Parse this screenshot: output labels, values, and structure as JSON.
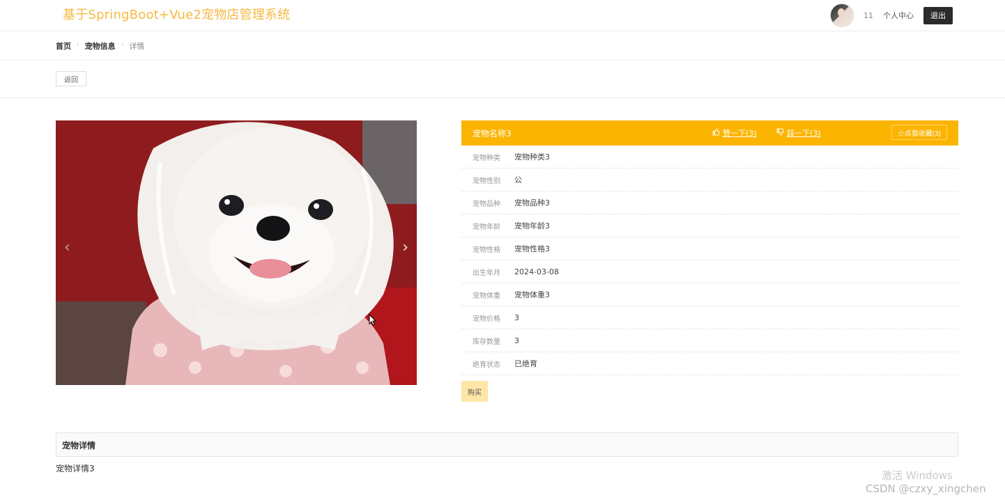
{
  "header": {
    "brand": "基于SpringBoot+Vue2宠物店管理系统",
    "user_id": "11",
    "profile_label": "个人中心",
    "logout_label": "退出"
  },
  "breadcrumb": {
    "items": [
      "首页",
      "宠物信息",
      "详情"
    ],
    "separator": "ᵌ"
  },
  "actions": {
    "back_label": "返回"
  },
  "carousel": {
    "prev_icon": "‹",
    "next_icon": "›"
  },
  "pet": {
    "name": "宠物名称3",
    "thumb_up": "赞一下(3)",
    "thumb_down": "踩一下(3)",
    "favorite": "☆点我收藏(3)",
    "fields": [
      {
        "label": "宠物种类",
        "value": "宠物种类3"
      },
      {
        "label": "宠物性别",
        "value": "公"
      },
      {
        "label": "宠物品种",
        "value": "宠物品种3"
      },
      {
        "label": "宠物年龄",
        "value": "宠物年龄3"
      },
      {
        "label": "宠物性格",
        "value": "宠物性格3"
      },
      {
        "label": "出生年月",
        "value": "2024-03-08"
      },
      {
        "label": "宠物体重",
        "value": "宠物体重3"
      },
      {
        "label": "宠物价格",
        "value": "3"
      },
      {
        "label": "库存数量",
        "value": "3"
      },
      {
        "label": "绝育状态",
        "value": "已绝育"
      }
    ],
    "buy_label": "购买"
  },
  "detail": {
    "title": "宠物详情",
    "content": "宠物详情3"
  },
  "watermarks": {
    "windows": "激活 Windows",
    "csdn": "CSDN @czxy_xingchen"
  },
  "colors": {
    "brand": "#f4b942",
    "accent": "#fbb400",
    "buy_button": "#fde6a6"
  }
}
